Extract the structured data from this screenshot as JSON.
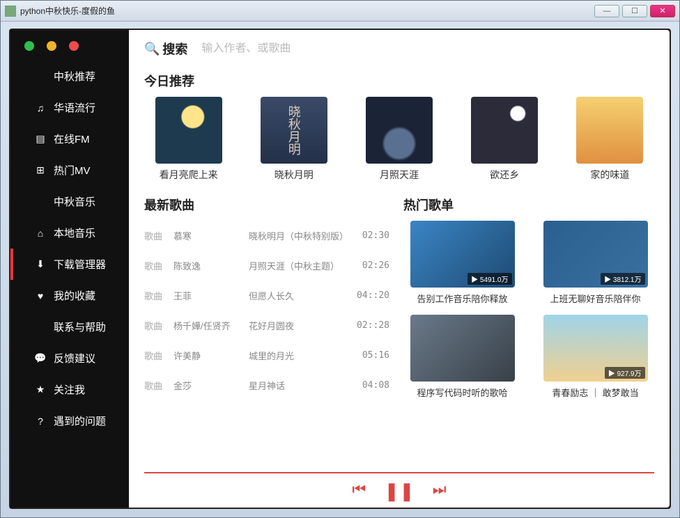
{
  "window": {
    "title": "python中秋快乐-度假的鱼"
  },
  "sidebar": {
    "items": [
      {
        "icon": "",
        "label": "中秋推荐"
      },
      {
        "icon": "♫",
        "label": "华语流行"
      },
      {
        "icon": "▤",
        "label": "在线FM"
      },
      {
        "icon": "⊞",
        "label": "热门MV"
      },
      {
        "icon": "",
        "label": "中秋音乐"
      },
      {
        "icon": "⌂",
        "label": "本地音乐"
      },
      {
        "icon": "⬇",
        "label": "下载管理器",
        "active": true
      },
      {
        "icon": "♥",
        "label": "我的收藏"
      },
      {
        "icon": "",
        "label": "联系与帮助"
      },
      {
        "icon": "💬",
        "label": "反馈建议"
      },
      {
        "icon": "★",
        "label": "关注我"
      },
      {
        "icon": "?",
        "label": "遇到的问题"
      }
    ]
  },
  "search": {
    "label": "搜索",
    "placeholder": "输入作者、或歌曲"
  },
  "sections": {
    "today": "今日推荐",
    "latest": "最新歌曲",
    "hot": "热门歌单"
  },
  "recommend": [
    {
      "title": "看月亮爬上来"
    },
    {
      "title": "晓秋月明",
      "overlay": "晓秋月明"
    },
    {
      "title": "月照天涯"
    },
    {
      "title": "欲还乡"
    },
    {
      "title": "家的味道"
    }
  ],
  "songs": [
    {
      "tag": "歌曲",
      "artist": "慕寒",
      "title": "晓秋明月（中秋特别版）",
      "dur": "02:30"
    },
    {
      "tag": "歌曲",
      "artist": "陈致逸",
      "title": "月照天涯（中秋主题）",
      "dur": "02:26"
    },
    {
      "tag": "歌曲",
      "artist": "王菲",
      "title": "但愿人长久",
      "dur": "04::20"
    },
    {
      "tag": "歌曲",
      "artist": "杨千嬅/任贤齐",
      "title": "花好月圆夜",
      "dur": "02::28"
    },
    {
      "tag": "歌曲",
      "artist": "许美静",
      "title": "城里的月光",
      "dur": "05:16"
    },
    {
      "tag": "歌曲",
      "artist": "金莎",
      "title": "星月神话",
      "dur": "04:08"
    }
  ],
  "playlists": [
    {
      "title": "告别工作音乐陪你释放",
      "badge": "▶ 5491.0万"
    },
    {
      "title": "上班无聊好音乐陪伴你",
      "badge": "▶ 3812.1万"
    },
    {
      "title": "程序写代码时听的歌哈",
      "badge": ""
    },
    {
      "title": "青春励志 ｜ 敢梦敢当",
      "badge": "▶ 927.9万"
    }
  ]
}
